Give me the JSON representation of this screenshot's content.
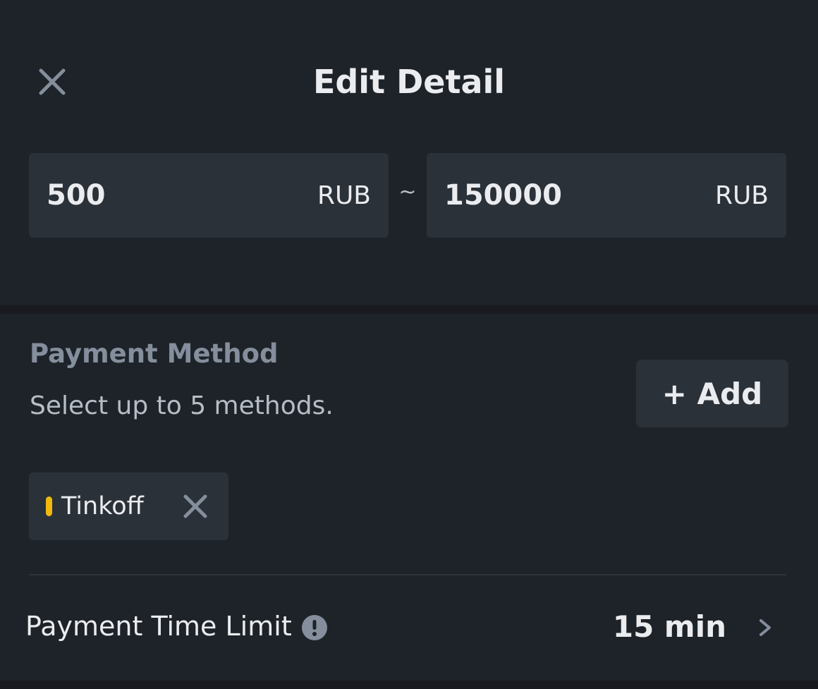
{
  "header": {
    "title": "Edit Detail",
    "close_icon": "close-icon"
  },
  "amount_range": {
    "min_value": "500",
    "min_unit": "RUB",
    "separator": "~",
    "max_value": "150000",
    "max_unit": "RUB"
  },
  "payment_method": {
    "title": "Payment Method",
    "subtitle": "Select up to 5 methods.",
    "add_label": "+ Add",
    "methods": [
      {
        "label": "Tinkoff",
        "accent_color": "#f0b90b"
      }
    ]
  },
  "time_limit": {
    "label": "Payment Time Limit",
    "value": "15 min",
    "info_icon": "info-icon",
    "chevron_icon": "chevron-right-icon"
  },
  "colors": {
    "background": "#1e2329",
    "panel": "#2b3139",
    "divider": "#181a20",
    "text_primary": "#eaecef",
    "text_secondary": "#848e9c",
    "accent": "#f0b90b"
  }
}
